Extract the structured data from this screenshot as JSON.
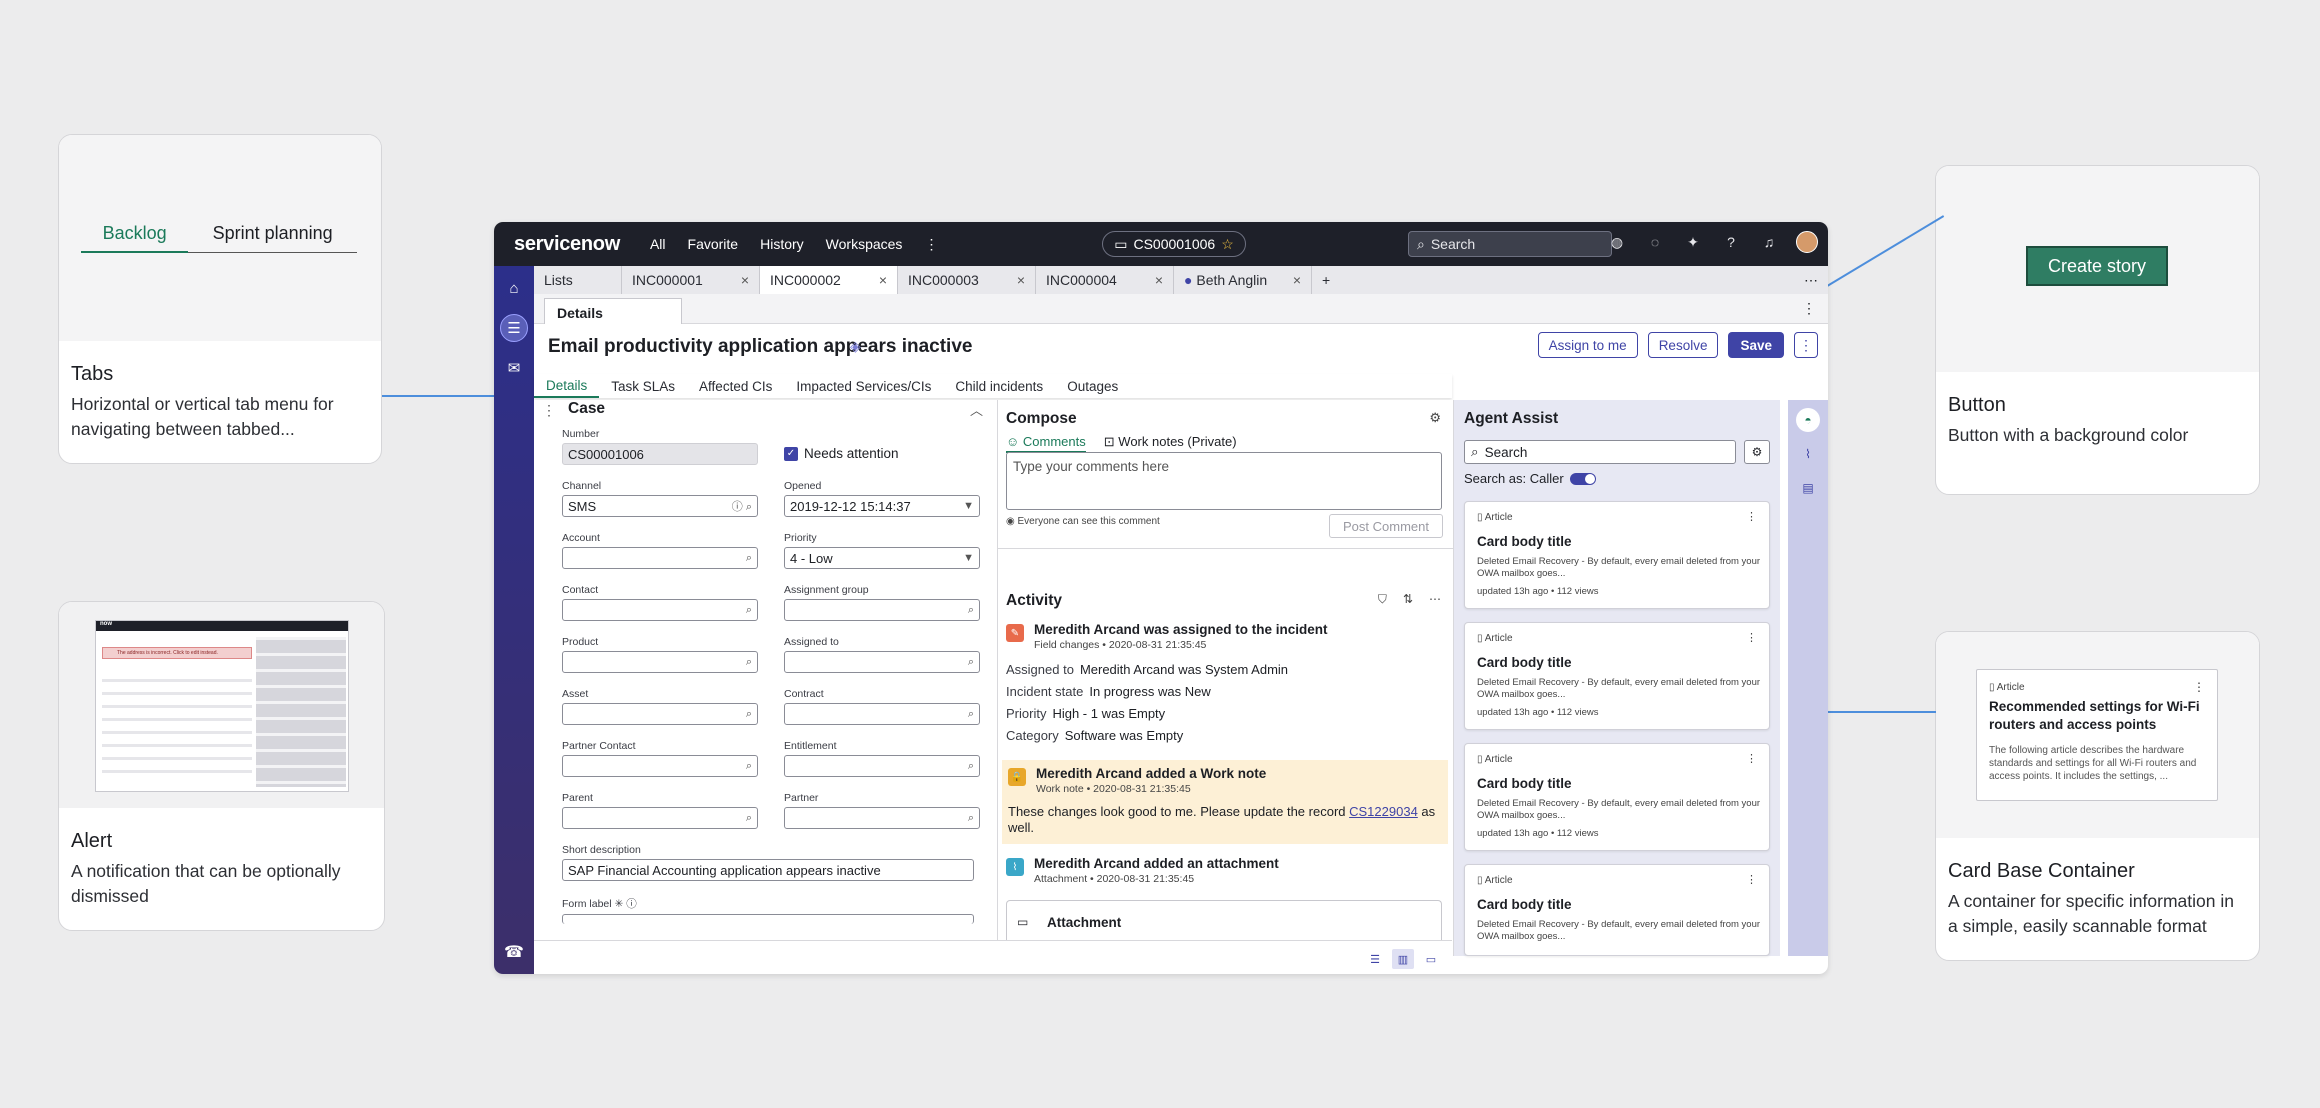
{
  "callouts": {
    "tabs": {
      "title": "Tabs",
      "desc": "Horizontal or vertical tab menu for navigating between tabbed...",
      "preview_tabs": [
        "Backlog",
        "Sprint planning"
      ]
    },
    "alert": {
      "title": "Alert",
      "desc": "A notification that can be optionally dismissed",
      "preview_brand": "now",
      "preview_alert": "The address is incorrect. Click to edit instead."
    },
    "button": {
      "title": "Button",
      "desc": "Button with a background color",
      "preview_label": "Create story"
    },
    "card": {
      "title": "Card Base Container",
      "desc": "A container for specific information in a simple, easily scannable format",
      "preview": {
        "type": "Article",
        "title": "Recommended settings for Wi-Fi routers and access points",
        "body": "The following article describes the hardware standards and settings for all Wi-Fi routers and access points. It includes the settings, ..."
      }
    }
  },
  "topbar": {
    "logo": "servicenow",
    "nav": [
      "All",
      "Favorite",
      "History",
      "Workspaces"
    ],
    "record_chip": "CS00001006",
    "search_placeholder": "Search"
  },
  "tabs": [
    {
      "label": "Lists"
    },
    {
      "label": "INC000001"
    },
    {
      "label": "INC000002"
    },
    {
      "label": "INC000003"
    },
    {
      "label": "INC000004"
    },
    {
      "label": "Beth Anglin"
    }
  ],
  "subtab": "Details",
  "header": {
    "title": "Email productivity application appears inactive",
    "assign": "Assign to me",
    "resolve": "Resolve",
    "save": "Save"
  },
  "form_tabs": [
    "Details",
    "Task SLAs",
    "Affected CIs",
    "Impacted Services/CIs",
    "Child incidents",
    "Outages"
  ],
  "case": {
    "title": "Case",
    "number_label": "Number",
    "number": "CS00001006",
    "needs_attention": "Needs attention",
    "channel_label": "Channel",
    "channel": "SMS",
    "opened_label": "Opened",
    "opened": "2019-12-12 15:14:37",
    "account_label": "Account",
    "priority_label": "Priority",
    "priority": "4 - Low",
    "contact_label": "Contact",
    "assignment_group_label": "Assignment group",
    "product_label": "Product",
    "assigned_to_label": "Assigned to",
    "asset_label": "Asset",
    "contract_label": "Contract",
    "partner_contact_label": "Partner Contact",
    "entitlement_label": "Entitlement",
    "parent_label": "Parent",
    "partner_label": "Partner",
    "short_desc_label": "Short description",
    "short_desc": "SAP Financial Accounting application appears inactive",
    "form_label": "Form label"
  },
  "compose": {
    "title": "Compose",
    "tab_comments": "Comments",
    "tab_worknotes": "Work notes (Private)",
    "placeholder": "Type your comments here",
    "note": "Everyone can see this comment",
    "post": "Post Comment"
  },
  "activity": {
    "title": "Activity",
    "items": [
      {
        "title": "Meredith Arcand was assigned to the incident",
        "sub": "Field changes  •  2020-08-31 21:35:45",
        "fields": [
          {
            "k": "Assigned to",
            "v": "Meredith Arcand was System Admin"
          },
          {
            "k": "Incident state",
            "v": "In progress was New"
          },
          {
            "k": "Priority",
            "v": "High - 1 was Empty"
          },
          {
            "k": "Category",
            "v": "Software was Empty"
          }
        ]
      },
      {
        "title": "Meredith Arcand added a Work note",
        "sub": "Work note  •  2020-08-31 21:35:45",
        "body_pre": "These changes look good to me. Please update the record ",
        "link": "CS1229034",
        "body_post": " as well."
      },
      {
        "title": "Meredith Arcand added an attachment",
        "sub": "Attachment  •  2020-08-31 21:35:45",
        "attachment": "Attachment"
      }
    ]
  },
  "agent": {
    "title": "Agent Assist",
    "search_placeholder": "Search",
    "search_as": "Search as: Caller",
    "cards": [
      {
        "type": "Article",
        "title": "Card body title",
        "body": "Deleted Email Recovery - By default, every email deleted from your OWA mailbox goes...",
        "meta": "updated 13h ago  •  112 views"
      },
      {
        "type": "Article",
        "title": "Card body title",
        "body": "Deleted Email Recovery - By default, every email deleted from your OWA mailbox goes...",
        "meta": "updated 13h ago  •  112 views"
      },
      {
        "type": "Article",
        "title": "Card body title",
        "body": "Deleted Email Recovery - By default, every email deleted from your OWA mailbox goes...",
        "meta": "updated 13h ago  •  112 views"
      },
      {
        "type": "Article",
        "title": "Card body title",
        "body": "Deleted Email Recovery - By default, every email deleted from your OWA mailbox goes...",
        "meta": ""
      }
    ]
  },
  "colors": {
    "accent": "#3f44a6",
    "brand_green": "#1b7a5a",
    "connector": "#4d8edc",
    "topbar": "#1e2029"
  }
}
